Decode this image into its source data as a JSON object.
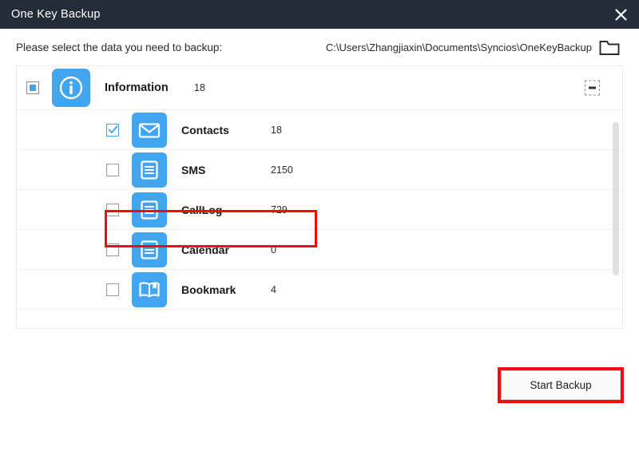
{
  "window": {
    "title": "One Key Backup",
    "close_icon": "close-icon"
  },
  "header": {
    "instruction": "Please select the data you need to backup:",
    "backup_path": "C:\\Users\\Zhangjiaxin\\Documents\\Syncios\\OneKeyBackup",
    "folder_icon": "folder-icon"
  },
  "list": {
    "parent": {
      "label": "Information",
      "count": "18",
      "icon": "info-icon",
      "checkbox_state": "indeterminate",
      "expand_icon": "collapse-box-icon"
    },
    "items": [
      {
        "label": "Contacts",
        "count": "18",
        "icon": "envelope-icon",
        "checkbox_state": "checked",
        "highlighted": true
      },
      {
        "label": "SMS",
        "count": "2150",
        "icon": "document-icon",
        "checkbox_state": "unchecked",
        "highlighted": false
      },
      {
        "label": "CallLog",
        "count": "729",
        "icon": "document-icon",
        "checkbox_state": "unchecked",
        "highlighted": false
      },
      {
        "label": "Calendar",
        "count": "0",
        "icon": "document-icon",
        "checkbox_state": "unchecked",
        "highlighted": false
      },
      {
        "label": "Bookmark",
        "count": "4",
        "icon": "book-icon",
        "checkbox_state": "unchecked",
        "highlighted": false
      }
    ]
  },
  "footer": {
    "start_backup_label": "Start Backup"
  },
  "colors": {
    "titlebar": "#242c3a",
    "accent_blue": "#41a5ef",
    "highlight_red": "#f40c0c",
    "row_divider": "#efefef"
  }
}
